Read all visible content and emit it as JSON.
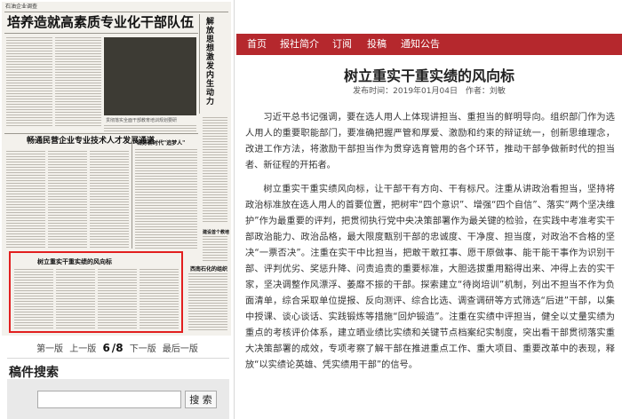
{
  "newspaper": {
    "section_tag": "石油企业调查",
    "headline_main": "培养造就高素质专业化干部队伍",
    "headline_side": "解放思想激发内生动力",
    "headline_mid": "畅通民营企业专业技术人才发展通道",
    "headline_small_1": "当好新时代\"追梦人\"",
    "headline_small_2": "建设首个教培",
    "headline_small_3": "西南石化的组织",
    "photo_caption": "贯彻落实全面干部教育培训规划要研",
    "highlighted_article_title": "树立重实干重实绩的风向标"
  },
  "pager": {
    "first": "第一版",
    "prev": "上一版",
    "current": "6",
    "separator": "/",
    "total": "8",
    "next": "下一版",
    "last": "最后一版"
  },
  "search": {
    "title": "稿件搜索",
    "input_value": "",
    "button_label": "搜 索"
  },
  "colors": {
    "nav_bg": "#b5282d",
    "highlight_border": "#e21f1f"
  },
  "nav": {
    "items": [
      "首页",
      "报社简介",
      "订阅",
      "投稿",
      "通知公告"
    ]
  },
  "article": {
    "title": "树立重实干重实绩的风向标",
    "publish_label": "发布时间：2019年01月04日",
    "author_label": "作者：刘敏",
    "paragraphs": [
      "习近平总书记强调，要在选人用人上体现讲担当、重担当的鲜明导向。组织部门作为选人用人的重要职能部门，要准确把握严管和厚爱、激励和约束的辩证统一，创新思维理念，改进工作方法，将激励干部担当作为贯穿选育管用的各个环节，推动干部争做新时代的担当者、新征程的开拓者。",
      "树立重实干重实绩风向标，让干部干有方向、干有标尺。注重从讲政治看担当，坚持将政治标准放在选人用人的首要位置，把树牢“四个意识”、增强“四个自信”、落实“两个坚决维护”作为最重要的评判，把贯彻执行党中央决策部署作为最关键的检验，在实践中考准考实干部政治能力、政治品格，最大限度甄别干部的忠诚度、干净度、担当度，对政治不合格的坚决“一票否决”。注重在实干中比担当，把敢干敢扛事、愿干原做事、能干能干事作为识别干部、评判优劣、奖惩升降、问责追责的重要标准，大胆选拔重用豁得出来、冲得上去的实干家，坚决调整作风漂浮、萎靡不振的干部。探索建立“待岗培训”机制，列出不担当不作为负面清单，综合采取单位提报、反向测评、综合比选、调查调研等方式筛选“后进”干部，以集中授课、谈心谈话、实践锻炼等措施“回炉锻造”。注重在实绩中评担当，健全以丈量实绩为重点的考核评价体系，建立晒业绩比实绩和关键节点档案纪实制度，突出看干部贯彻落实重大决策部署的成效，专项考察了解干部在推进重点工作、重大项目、重要改革中的表现，释放“以实绩论英雄、凭实绩用干部”的信号。"
    ]
  }
}
